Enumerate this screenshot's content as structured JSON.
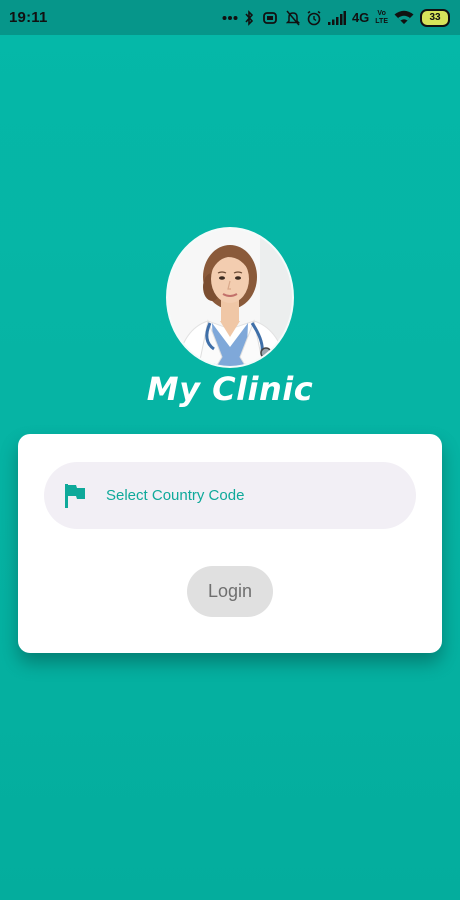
{
  "status_bar": {
    "time": "19:11",
    "network": "4G",
    "volte_top": "Vo",
    "volte_bottom": "LTE",
    "battery": "33",
    "icons": [
      "more-dots-icon",
      "bluetooth-icon",
      "vibrate-icon",
      "alarm-off-icon",
      "alarm-icon",
      "signal-icon",
      "volte-icon",
      "wifi-icon",
      "battery-icon"
    ]
  },
  "app": {
    "title": "My Clinic",
    "avatar": "doctor-avatar"
  },
  "login_card": {
    "country_select_label": "Select Country Code",
    "country_select_icon": "flag-icon",
    "login_label": "Login"
  },
  "colors": {
    "background": "#05b8a8",
    "status_bar": "#06968a",
    "accent": "#0fa99a",
    "field_bg": "#f2eff5",
    "button_bg": "#e0e0e0"
  }
}
